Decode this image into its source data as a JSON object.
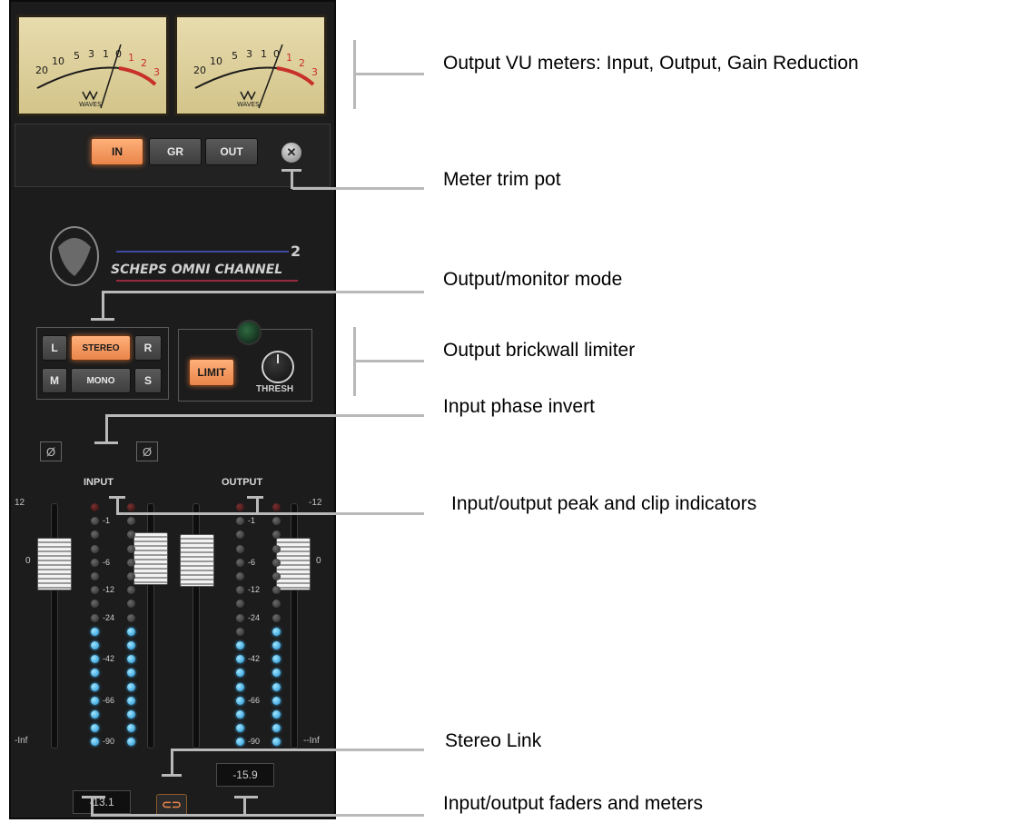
{
  "meters": {
    "vu_scale_left": [
      "20",
      "10",
      "5",
      "3",
      "1",
      "0"
    ],
    "vu_scale_right": [
      "1",
      "2",
      "3"
    ],
    "brand": "WAVES",
    "buttons": {
      "in": "IN",
      "gr": "GR",
      "out": "OUT"
    }
  },
  "logo": {
    "title": "SCHEPS OMNI CHANNEL",
    "version": "2"
  },
  "monitor": {
    "l": "L",
    "stereo": "STEREO",
    "r": "R",
    "m": "M",
    "mono": "MONO",
    "s": "S"
  },
  "limiter": {
    "limit": "LIMIT",
    "thresh": "THRESH"
  },
  "phase": {
    "symbol": "Ø"
  },
  "input": {
    "label": "INPUT",
    "scale_top": "12",
    "scale_zero": "0",
    "scale_bottom": "-Inf",
    "readout": "-13.1"
  },
  "output": {
    "label": "OUTPUT",
    "scale_top": "-12",
    "scale_zero": "0",
    "scale_bottom": "--Inf",
    "readout": "-15.9"
  },
  "led_scale": [
    "-1",
    "-6",
    "-12",
    "-24",
    "-42",
    "-66",
    "-90"
  ],
  "annotations": {
    "vu": "Output VU meters: Input, Output, Gain Reduction",
    "trim": "Meter trim pot",
    "monitor": "Output/monitor mode",
    "limiter": "Output brickwall limiter",
    "phase": "Input phase invert",
    "peak": "Input/output peak and clip indicators",
    "link": "Stereo Link",
    "faders": "Input/output faders and meters"
  },
  "colors": {
    "accent": "#e9854a",
    "led_on": "#1f8fd0",
    "panel": "#1c1c1c",
    "vu_face": "#e0d3a0"
  }
}
